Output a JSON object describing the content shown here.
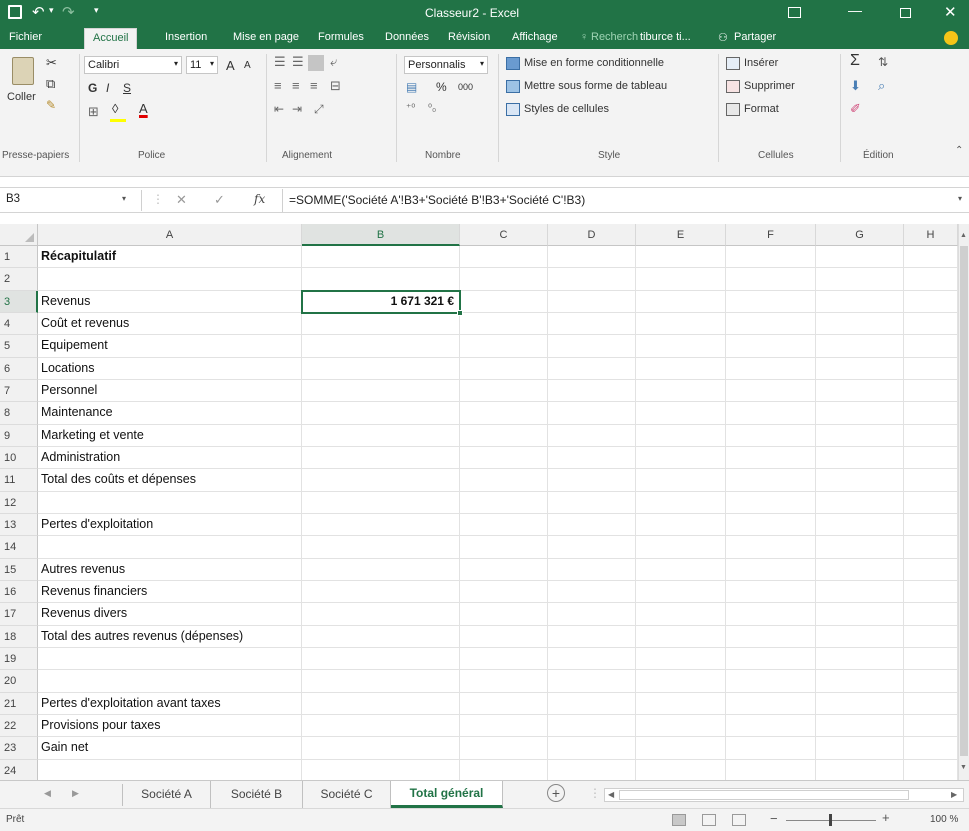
{
  "window": {
    "title": "Classeur2 - Excel",
    "colors": {
      "brand": "#217346",
      "selection": "#217346"
    }
  },
  "ribbon_tabs": [
    "Fichier",
    "Accueil",
    "Insertion",
    "Mise en page",
    "Formules",
    "Données",
    "Révision",
    "Affichage"
  ],
  "active_tab": "Accueil",
  "tell_me": "Recherch",
  "user": "tiburce ti...",
  "share": "Partager",
  "ribbon": {
    "clipboard": {
      "paste": "Coller",
      "group": "Presse-papiers"
    },
    "font": {
      "name": "Calibri",
      "size": "11",
      "bold": "G",
      "italic": "I",
      "underline": "S",
      "grow": "A",
      "shrink": "A",
      "color_letter": "A",
      "group": "Police"
    },
    "alignment": {
      "group": "Alignement"
    },
    "number": {
      "format": "Personnalis",
      "percent": "%",
      "thousands": "000",
      "group": "Nombre"
    },
    "style": {
      "cond": "Mise en forme conditionnelle",
      "table": "Mettre sous forme de tableau",
      "cellstyles": "Styles de cellules",
      "group": "Style"
    },
    "cells": {
      "insert": "Insérer",
      "delete": "Supprimer",
      "format": "Format",
      "group": "Cellules"
    },
    "editing": {
      "group": "Édition"
    }
  },
  "formula_bar": {
    "name_box": "B3",
    "cancel": "✕",
    "enter": "✓",
    "fx": "fx",
    "formula": "=SOMME('Société A'!B3+'Société B'!B3+'Société C'!B3)"
  },
  "columns": [
    "A",
    "B",
    "C",
    "D",
    "E",
    "F",
    "G",
    "H"
  ],
  "rows": [
    {
      "n": "1",
      "a": "Récapitulatif",
      "bold": true
    },
    {
      "n": "2",
      "a": ""
    },
    {
      "n": "3",
      "a": "Revenus"
    },
    {
      "n": "4",
      "a": "Coût et revenus"
    },
    {
      "n": "5",
      "a": " Equipement"
    },
    {
      "n": "6",
      "a": " Locations"
    },
    {
      "n": "7",
      "a": " Personnel"
    },
    {
      "n": "8",
      "a": " Maintenance"
    },
    {
      "n": "9",
      "a": " Marketing et vente"
    },
    {
      "n": "10",
      "a": " Administration"
    },
    {
      "n": "11",
      "a": "Total des coûts et dépenses"
    },
    {
      "n": "12",
      "a": ""
    },
    {
      "n": "13",
      "a": "Pertes d'exploitation"
    },
    {
      "n": "14",
      "a": ""
    },
    {
      "n": "15",
      "a": "Autres revenus"
    },
    {
      "n": "16",
      "a": " Revenus financiers"
    },
    {
      "n": "17",
      "a": " Revenus divers"
    },
    {
      "n": "18",
      "a": "Total des autres revenus (dépenses)"
    },
    {
      "n": "19",
      "a": ""
    },
    {
      "n": "20",
      "a": ""
    },
    {
      "n": "21",
      "a": "Pertes d'exploitation avant taxes"
    },
    {
      "n": "22",
      "a": "Provisions pour taxes"
    },
    {
      "n": "23",
      "a": "Gain net"
    },
    {
      "n": "24",
      "a": ""
    }
  ],
  "selected_cell": {
    "ref": "B3",
    "value": "1 671 321 €"
  },
  "sheets": [
    "Société A",
    "Société B",
    "Société C",
    "Total général"
  ],
  "active_sheet": "Total général",
  "status": {
    "ready": "Prêt",
    "zoom": "100 %"
  }
}
